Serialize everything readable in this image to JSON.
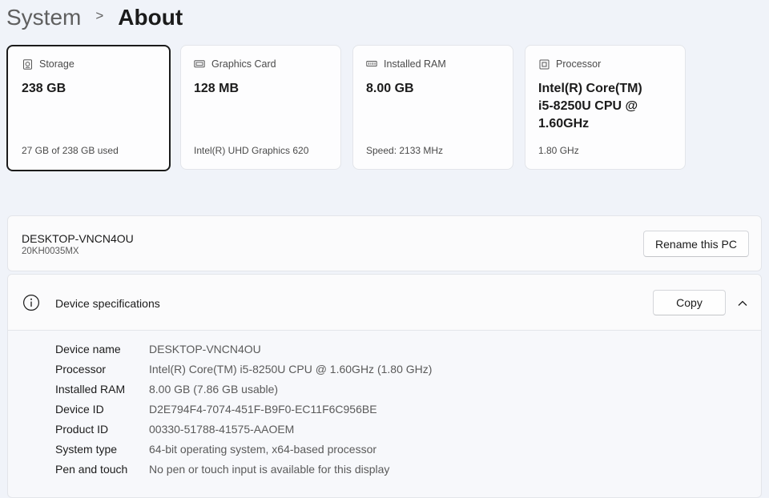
{
  "breadcrumb": {
    "parent": "System",
    "separator": ">",
    "current": "About"
  },
  "cards": [
    {
      "icon": "storage-icon",
      "label": "Storage",
      "value": "238 GB",
      "sub": "27 GB of 238 GB used",
      "selected": true
    },
    {
      "icon": "graphics-card-icon",
      "label": "Graphics Card",
      "value": "128 MB",
      "sub": "Intel(R) UHD Graphics 620",
      "selected": false
    },
    {
      "icon": "ram-icon",
      "label": "Installed RAM",
      "value": "8.00 GB",
      "sub": "Speed: 2133 MHz",
      "selected": false
    },
    {
      "icon": "processor-icon",
      "label": "Processor",
      "value": "Intel(R) Core(TM) i5-8250U CPU @ 1.60GHz",
      "sub": "1.80 GHz",
      "selected": false
    }
  ],
  "pc": {
    "name": "DESKTOP-VNCN4OU",
    "model": "20KH0035MX",
    "rename_label": "Rename this PC"
  },
  "specs": {
    "title": "Device specifications",
    "copy_label": "Copy",
    "rows": [
      {
        "label": "Device name",
        "value": "DESKTOP-VNCN4OU"
      },
      {
        "label": "Processor",
        "value": "Intel(R) Core(TM) i5-8250U CPU @ 1.60GHz (1.80 GHz)"
      },
      {
        "label": "Installed RAM",
        "value": "8.00 GB (7.86 GB usable)"
      },
      {
        "label": "Device ID",
        "value": "D2E794F4-7074-451F-B9F0-EC11F6C956BE"
      },
      {
        "label": "Product ID",
        "value": "00330-51788-41575-AAOEM"
      },
      {
        "label": "System type",
        "value": "64-bit operating system, x64-based processor"
      },
      {
        "label": "Pen and touch",
        "value": "No pen or touch input is available for this display"
      }
    ]
  }
}
